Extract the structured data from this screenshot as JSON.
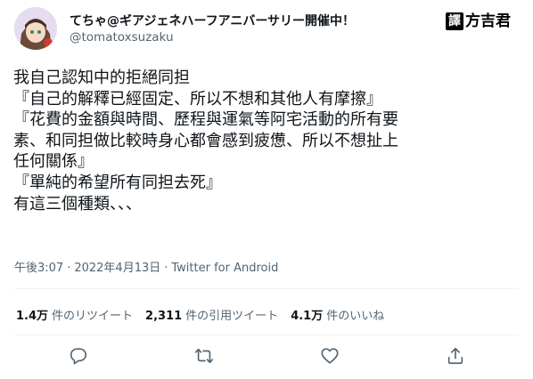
{
  "author": {
    "display_name": "てちゃ@ギアジェネハーフアニバーサリー開催中！",
    "handle": "@tomatoxsuzaku"
  },
  "watermark": {
    "box_label": "譯",
    "name": "方吉君"
  },
  "tweet": {
    "lines": [
      "我自己認知中的拒絕同担",
      "『自己的解釋已經固定、所以不想和其他人有摩擦』",
      "『花費的金額與時間、歷程與運氣等阿宅活動的所有要",
      "素、和同担做比較時身心都會感到疲憊、所以不想扯上",
      "任何關係』",
      "『單純的希望所有同担去死』",
      "有這三個種類、、、"
    ],
    "time": "午後3:07",
    "date": "2022年4月13日",
    "source": "Twitter for Android"
  },
  "stats": {
    "retweets_count": "1.4万",
    "retweets_label": "件のリツイート",
    "quotes_count": "2,311",
    "quotes_label": "件の引用ツイート",
    "likes_count": "4.1万",
    "likes_label": "件のいいね"
  },
  "icons": {
    "reply": "reply-icon",
    "retweet": "retweet-icon",
    "like": "heart-icon",
    "share": "share-icon"
  },
  "colors": {
    "text_primary": "#0f1419",
    "text_secondary": "#536471",
    "divider": "#eff3f4"
  }
}
